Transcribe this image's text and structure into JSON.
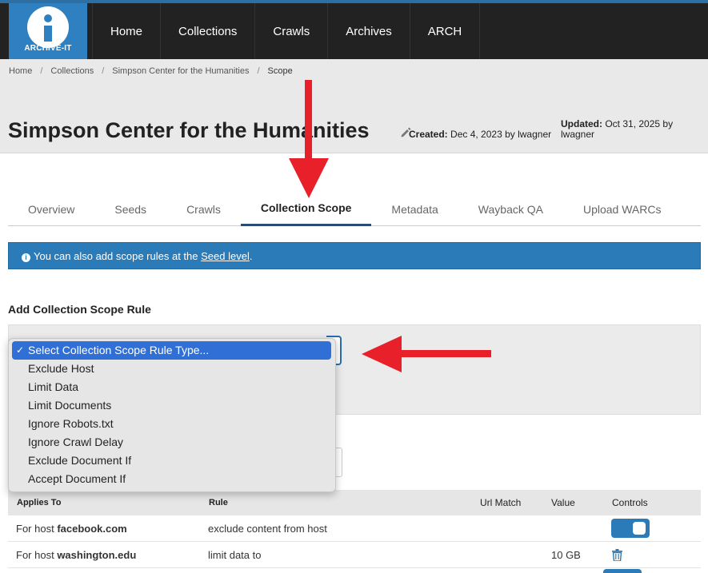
{
  "nav": {
    "logo_text": "ARCHIVE-IT",
    "items": [
      {
        "label": "Home"
      },
      {
        "label": "Collections"
      },
      {
        "label": "Crawls"
      },
      {
        "label": "Archives"
      },
      {
        "label": "ARCH"
      }
    ]
  },
  "breadcrumb": {
    "items": [
      "Home",
      "Collections",
      "Simpson Center for the Humanities"
    ],
    "current": "Scope"
  },
  "page": {
    "title": "Simpson Center for the Humanities",
    "created_label": "Created:",
    "created_value": "Dec 4, 2023 by lwagner",
    "updated_label": "Updated:",
    "updated_value": "Oct 31, 2025 by lwagner"
  },
  "tabs": [
    {
      "label": "Overview"
    },
    {
      "label": "Seeds"
    },
    {
      "label": "Crawls"
    },
    {
      "label": "Collection Scope",
      "active": true
    },
    {
      "label": "Metadata"
    },
    {
      "label": "Wayback QA"
    },
    {
      "label": "Upload WARCs"
    }
  ],
  "info": {
    "text_before": "You can also add scope rules at the ",
    "link": "Seed level",
    "text_after": "."
  },
  "add_rule": {
    "title": "Add Collection Scope Rule"
  },
  "dropdown": {
    "options": [
      "Select Collection Scope Rule Type...",
      "Exclude Host",
      "Limit Data",
      "Limit Documents",
      "Ignore Robots.txt",
      "Ignore Crawl Delay",
      "Exclude Document If",
      "Accept Document If"
    ],
    "selected_index": 0,
    "check": "✓"
  },
  "table": {
    "headers": {
      "applies_to": "Applies To",
      "rule": "Rule",
      "url_match": "Url Match",
      "value": "Value",
      "controls": "Controls"
    },
    "rows": [
      {
        "prefix": "For host ",
        "host": "facebook.com",
        "rule": "exclude content from host",
        "value": "",
        "control": "toggle"
      },
      {
        "prefix": "For host ",
        "host": "washington.edu",
        "rule": "limit data to",
        "value": "10 GB",
        "control": "trash"
      }
    ]
  },
  "colors": {
    "nav_bg": "#222222",
    "brand_blue": "#2f80c0",
    "info_blue": "#2b7bb9",
    "dropdown_highlight": "#2f6fd6",
    "arrow_red": "#e8202a"
  },
  "icons": {
    "edit": "pencil-icon",
    "info": "info-circle-icon",
    "trash": "trash-icon",
    "check": "checkmark-icon"
  }
}
